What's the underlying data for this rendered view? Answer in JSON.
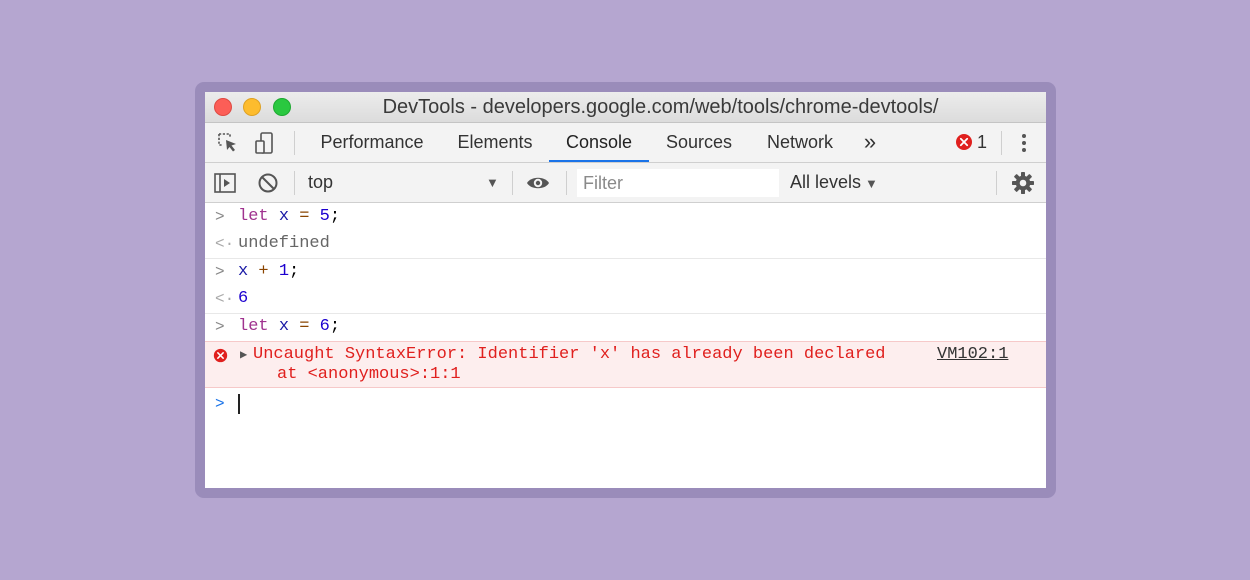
{
  "window": {
    "title": "DevTools - developers.google.com/web/tools/chrome-devtools/"
  },
  "tabs": [
    {
      "label": "Performance",
      "active": false
    },
    {
      "label": "Elements",
      "active": false
    },
    {
      "label": "Console",
      "active": true
    },
    {
      "label": "Sources",
      "active": false
    },
    {
      "label": "Network",
      "active": false
    }
  ],
  "tabbar": {
    "overflow": "»",
    "error_count": "1"
  },
  "filterbar": {
    "context": "top",
    "filter_placeholder": "Filter",
    "levels": "All levels"
  },
  "console": {
    "entries": [
      {
        "type": "input",
        "kw": "let",
        "var": "x",
        "op": "=",
        "num": "5",
        "end": ";"
      },
      {
        "type": "result",
        "text": "undefined"
      },
      {
        "type": "input",
        "var": "x",
        "op": "+",
        "num": "1",
        "end": ";"
      },
      {
        "type": "result",
        "text": "6"
      },
      {
        "type": "input",
        "kw": "let",
        "var": "x",
        "op": "=",
        "num": "6",
        "end": ";"
      }
    ],
    "error": {
      "message": "Uncaught SyntaxError: Identifier 'x' has already been declared",
      "stack": "at <anonymous>:1:1",
      "source": "VM102:1"
    }
  },
  "colors": {
    "accent": "#1a73e8",
    "error": "#e0201e",
    "keyword": "#a0328f",
    "background": "#b5a6d0"
  }
}
